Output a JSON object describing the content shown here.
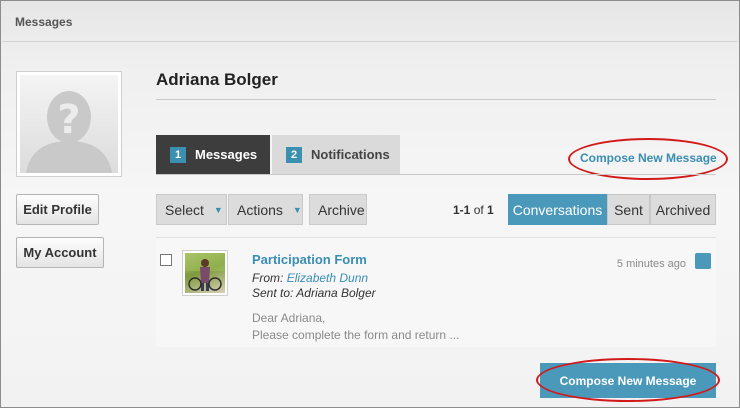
{
  "panel": {
    "title": "Messages"
  },
  "sidebar": {
    "edit_profile": "Edit Profile",
    "my_account": "My Account"
  },
  "user": {
    "name": "Adriana Bolger"
  },
  "tabs": [
    {
      "count": "1",
      "label": "Messages",
      "active": true
    },
    {
      "count": "2",
      "label": "Notifications",
      "active": false
    }
  ],
  "compose_link": "Compose New Message",
  "toolbar": {
    "select": "Select",
    "actions": "Actions",
    "archive": "Archive",
    "pager_range": "1-1",
    "pager_of": "of",
    "pager_total": "1",
    "views": [
      "Conversations",
      "Sent",
      "Archived"
    ]
  },
  "message": {
    "subject": "Participation Form",
    "from_label": "From:",
    "from_name": "Elizabeth Dunn",
    "sent_to_label": "Sent to:",
    "sent_to_name": "Adriana Bolger",
    "preview_line1": "Dear Adriana,",
    "preview_line2": "Please complete the form and return ...",
    "time": "5 minutes ago"
  },
  "compose_button": "Compose New Message",
  "colors": {
    "accent": "#4a98ba",
    "link": "#3a8db3",
    "annotation": "#d21a1a",
    "active_tab": "#3d3d3d"
  },
  "icons": {
    "avatar": "default-avatar-question-mark-icon",
    "caret": "caret-down-icon",
    "unread": "unread-indicator-icon"
  }
}
